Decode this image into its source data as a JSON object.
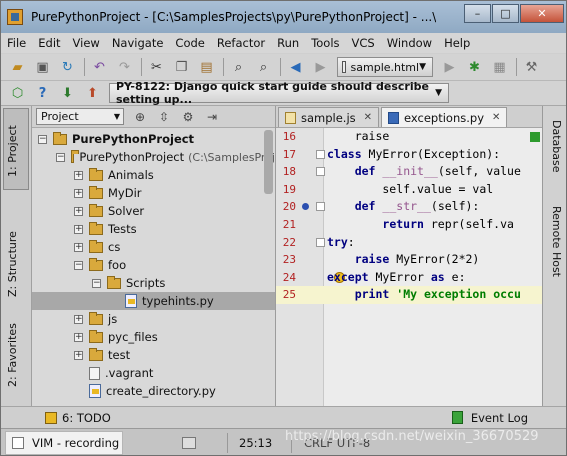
{
  "window": {
    "title": "PurePythonProject - [C:\\SamplesProjects\\py\\PurePythonProject] - ...\\exceptions.py - PyCharm",
    "minimize": "–",
    "maximize": "□",
    "close": "✕"
  },
  "menu": [
    "File",
    "Edit",
    "View",
    "Navigate",
    "Code",
    "Refactor",
    "Run",
    "Tools",
    "VCS",
    "Window",
    "Help"
  ],
  "toolbar": {
    "run_config": "sample.html",
    "task": "PY-8122: Django quick start guide should describe setting up..."
  },
  "left_tabs": {
    "project": "1: Project",
    "structure": "Z: Structure",
    "favorites": "2: Favorites"
  },
  "project_panel": {
    "view_select": "Project",
    "tree": [
      {
        "label": "PurePythonProject",
        "path": "",
        "indent": 0,
        "toggle": "−",
        "icon": "folder",
        "bold": true
      },
      {
        "label": "PurePythonProject",
        "path": "(C:\\SamplesProj",
        "indent": 1,
        "toggle": "−",
        "icon": "folder",
        "bold": false
      },
      {
        "label": "Animals",
        "path": "",
        "indent": 2,
        "toggle": "+",
        "icon": "folder",
        "bold": false
      },
      {
        "label": "MyDir",
        "path": "",
        "indent": 2,
        "toggle": "+",
        "icon": "folder",
        "bold": false
      },
      {
        "label": "Solver",
        "path": "",
        "indent": 2,
        "toggle": "+",
        "icon": "folder",
        "bold": false
      },
      {
        "label": "Tests",
        "path": "",
        "indent": 2,
        "toggle": "+",
        "icon": "folder",
        "bold": false
      },
      {
        "label": "cs",
        "path": "",
        "indent": 2,
        "toggle": "+",
        "icon": "folder",
        "bold": false
      },
      {
        "label": "foo",
        "path": "",
        "indent": 2,
        "toggle": "−",
        "icon": "folder",
        "bold": false
      },
      {
        "label": "Scripts",
        "path": "",
        "indent": 3,
        "toggle": "−",
        "icon": "folder",
        "bold": false
      },
      {
        "label": "typehints.py",
        "path": "",
        "indent": 4,
        "toggle": "",
        "icon": "py",
        "bold": false,
        "selected": true
      },
      {
        "label": "js",
        "path": "",
        "indent": 2,
        "toggle": "+",
        "icon": "folder",
        "bold": false
      },
      {
        "label": "pyc_files",
        "path": "",
        "indent": 2,
        "toggle": "+",
        "icon": "folder",
        "bold": false
      },
      {
        "label": "test",
        "path": "",
        "indent": 2,
        "toggle": "+",
        "icon": "folder",
        "bold": false
      },
      {
        "label": ".vagrant",
        "path": "",
        "indent": 2,
        "toggle": "",
        "icon": "file",
        "bold": false
      },
      {
        "label": "create_directory.py",
        "path": "",
        "indent": 2,
        "toggle": "",
        "icon": "py",
        "bold": false
      }
    ]
  },
  "editor": {
    "tabs": [
      {
        "label": "sample.js",
        "active": false
      },
      {
        "label": "exceptions.py",
        "active": true
      }
    ],
    "lines": [
      {
        "n": "16",
        "html": "    <span>raise</span>"
      },
      {
        "n": "17",
        "html": "<span class=\"kw\">class</span> MyError(Exception):"
      },
      {
        "n": "18",
        "html": "    <span class=\"kw\">def</span> <span class=\"mag\">__init__</span>(self, value"
      },
      {
        "n": "19",
        "html": "        self.value = val"
      },
      {
        "n": "20",
        "html": "    <span class=\"kw\">def</span> <span class=\"mag\">__str__</span>(self):"
      },
      {
        "n": "21",
        "html": "        <span class=\"kw\">return</span> repr(self.va"
      },
      {
        "n": "22",
        "html": "<span class=\"kw\">try</span>:"
      },
      {
        "n": "23",
        "html": "    <span class=\"kw\">raise</span> MyError(2*2)"
      },
      {
        "n": "24",
        "html": "<span class=\"kw\">except</span> MyError <span class=\"kw\">as</span> e:"
      },
      {
        "n": "25",
        "html": "    <span class=\"kw\">print</span> <span class=\"str\">'My exception occu</span>"
      }
    ]
  },
  "right_tabs": {
    "database": "Database",
    "remote_host": "Remote Host"
  },
  "bottom_bar": {
    "todo": "6: TODO",
    "event_log": "Event Log"
  },
  "status": {
    "vim": "VIM - recording",
    "position": "25:13",
    "extra": "CRLF  UTF-8",
    "watermark": "https://blog.csdn.net/weixin_36670529"
  }
}
